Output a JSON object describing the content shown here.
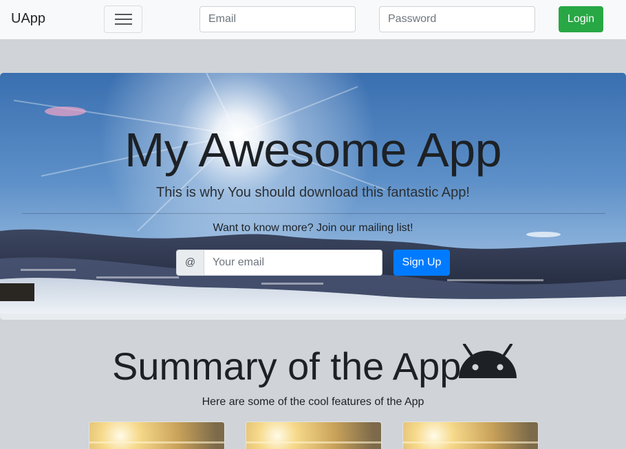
{
  "navbar": {
    "brand": "UApp",
    "email_placeholder": "Email",
    "password_placeholder": "Password",
    "login_label": "Login"
  },
  "hero": {
    "title": "My Awesome App",
    "lead": "This is why You should download this fantastic App!",
    "subtext": "Want to know more? Join our mailing list!",
    "prefix": "@",
    "email_placeholder": "Your email",
    "signup_label": "Sign Up"
  },
  "summary": {
    "title": "Summary of the App",
    "subtitle": "Here are some of the cool features of the App",
    "icon": "android-icon",
    "cards": [
      "card-1",
      "card-2",
      "card-3"
    ]
  },
  "colors": {
    "navbar_bg": "#f8f9fa",
    "login_button": "#28a745",
    "signup_button": "#007bff",
    "page_bg": "#d0d4d8"
  }
}
